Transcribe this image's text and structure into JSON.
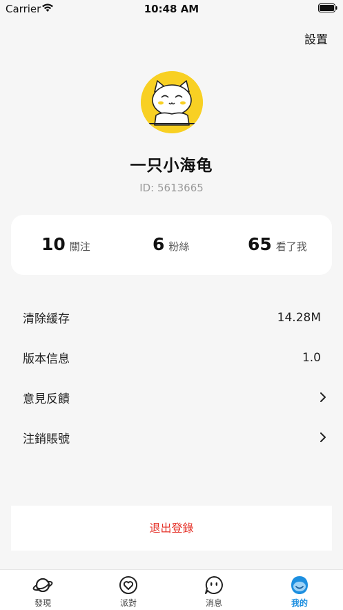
{
  "status_bar": {
    "carrier": "Carrier",
    "time": "10:48 AM"
  },
  "header": {
    "settings_label": "設置"
  },
  "profile": {
    "username": "一只小海龟",
    "user_id": "ID: 5613665",
    "avatar_color": "#f8d023"
  },
  "stats": [
    {
      "value": "10",
      "label": "關注"
    },
    {
      "value": "6",
      "label": "粉絲"
    },
    {
      "value": "65",
      "label": "看了我"
    }
  ],
  "menu": {
    "clear_cache": {
      "label": "清除緩存",
      "value": "14.28M"
    },
    "version": {
      "label": "版本信息",
      "value": "1.0"
    },
    "feedback": {
      "label": "意見反饋",
      "icon": "chevron-right-icon"
    },
    "deactivate": {
      "label": "注銷賬號",
      "icon": "chevron-right-icon"
    }
  },
  "logout": {
    "label": "退出登錄",
    "color": "#e5332a"
  },
  "tab_bar": {
    "active_color": "#1d8fe0",
    "tabs": [
      {
        "label": "發現",
        "icon": "planet-icon"
      },
      {
        "label": "派對",
        "icon": "heart-circle-icon"
      },
      {
        "label": "消息",
        "icon": "chat-face-icon"
      },
      {
        "label": "我的",
        "icon": "profile-face-icon",
        "active": true
      }
    ]
  }
}
